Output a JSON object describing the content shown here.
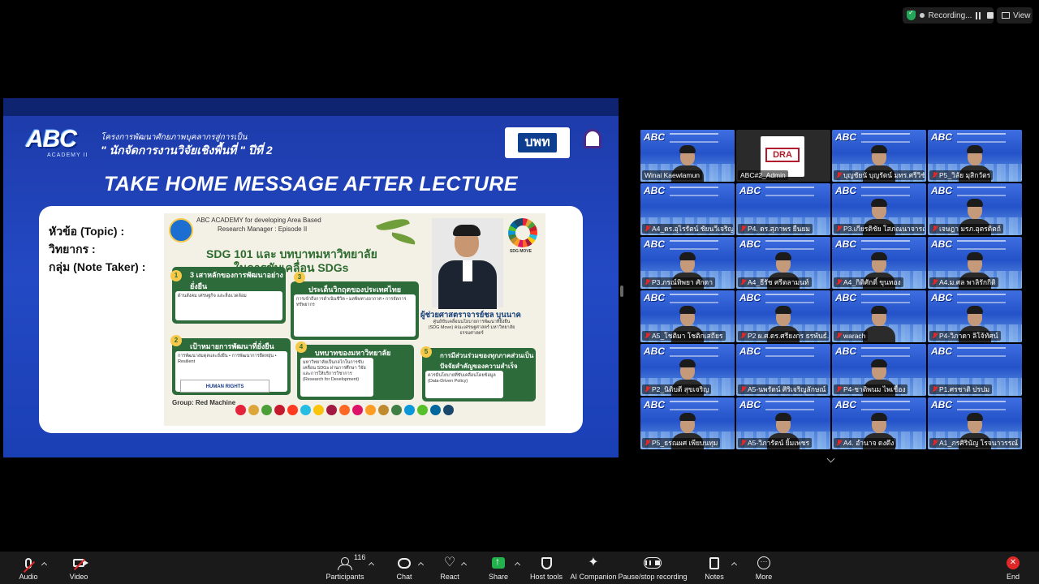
{
  "topbar": {
    "recording_label": "Recording...",
    "view_label": "View",
    "shield_icon": "shield-check-icon",
    "colors": {
      "shield": "#23a55a"
    }
  },
  "shared_slide": {
    "logo_text": "ABC",
    "logo_sub": "ACADEMY II",
    "project_line1": "โครงการพัฒนาศักยภาพบุคลากรสู่การเป็น",
    "project_line2": "\" นักจัดการงานวิจัยเชิงพื้นที่ \" ปีที่ 2",
    "partner_logo": "บพท",
    "title": "TAKE HOME MESSAGE AFTER LECTURE",
    "topic_label": "หัวข้อ (Topic) :",
    "speaker_label": "วิทยากร :",
    "group_label": "กลุ่ม (Note Taker) :",
    "note": {
      "header1": "ABC ACADEMY for developing Area Based",
      "header2": "Research Manager : Episode II",
      "title1": "SDG 101 และ บทบาทมหาวิทยาลัย",
      "title2": "ในการขับเคลื่อน SDGs",
      "sdg_move": "SDG MOVE",
      "speaker_name": "ผู้ช่วยศาสตราจารย์ชล บุนนาค",
      "speaker_desc": "ศูนย์ขับเคลื่อนนโยบายการพัฒนาที่ยั่งยืน (SDG Move) คณะเศรษฐศาสตร์ มหาวิทยาลัยธรรมศาสตร์",
      "box1_title": "3 เสาหลักของการพัฒนาอย่างยั่งยืน",
      "box1_body": "ด้านสังคม เศรษฐกิจ และสิ่งแวดล้อม",
      "box2_title": "เป้าหมายการพัฒนาที่ยั่งยืน",
      "box2_body": "การพัฒนาสมดุลและยั่งยืน • การพัฒนาการยืดหยุ่น • Resilient",
      "box3_title": "ประเด็นวิกฤตของประเทศไทย",
      "box3_body": "การเข้าถึงการดำเนินชีวิต • มลพิษทางอากาศ • การจัดการทรัพยากร",
      "box4_title": "บทบาทของมหาวิทยาลัย",
      "box4_body": "มหาวิทยาลัยเป็นกลไกในการขับเคลื่อน SDGs ผ่านการศึกษา วิจัย และการให้บริการวิชาการ (Research for Development)",
      "box5_title": "การมีส่วนร่วมของทุกภาคส่วนเป็นปัจจัยสำคัญของความสำเร็จ",
      "box5_body": "ควรมีนโยบายที่ขับเคลื่อนโดยข้อมูล (Data-Driven Policy)",
      "human_rights": "HUMAN RIGHTS",
      "group": "Group: Red Machine",
      "sdg_colors": [
        "#e5243b",
        "#dda63a",
        "#4c9f38",
        "#c5192d",
        "#ff3a21",
        "#26bde2",
        "#fcc30b",
        "#a21942",
        "#fd6925",
        "#dd1367",
        "#fd9d24",
        "#bf8b2e",
        "#3f7e44",
        "#0a97d9",
        "#56c02b",
        "#00689d",
        "#19486a"
      ]
    }
  },
  "gallery": {
    "participants": [
      {
        "name": "Winai Kaewlamun",
        "muted": false,
        "active": true,
        "kind": "video"
      },
      {
        "name": "ABC#2_Admin",
        "muted": false,
        "active": false,
        "kind": "logo"
      },
      {
        "name": "บุญชัยนั บุญรัตน์ มทร.ศรีวิชัย",
        "muted": true,
        "active": false,
        "kind": "video"
      },
      {
        "name": "P5_วิลัย มุสิกวัตร",
        "muted": true,
        "active": false,
        "kind": "video"
      },
      {
        "name": "A4_ดร.อุไรรัตน์ ชัยนวีเจริญ",
        "muted": true,
        "active": false,
        "kind": "bg"
      },
      {
        "name": "P4. ดร.สุภาพร ยืนยม",
        "muted": true,
        "active": false,
        "kind": "bg"
      },
      {
        "name": "P3.เกียรติชัย โสภณนาจารณ์",
        "muted": true,
        "active": false,
        "kind": "video"
      },
      {
        "name": "เจษฎา มรภ.อุตรดิตถ์",
        "muted": true,
        "active": false,
        "kind": "video"
      },
      {
        "name": "P3.ภรณ์ทิพยา ศักดา",
        "muted": true,
        "active": false,
        "kind": "video"
      },
      {
        "name": "A4_ธีรัช ศรีตลามนท์",
        "muted": true,
        "active": false,
        "kind": "video"
      },
      {
        "name": "A4_กิติศักดิ์ ขุนทอง",
        "muted": true,
        "active": false,
        "kind": "video"
      },
      {
        "name": "A4.ม.ศล พาลิรักกิติ",
        "muted": true,
        "active": false,
        "kind": "video"
      },
      {
        "name": "A5_โชติมา โชติกเสถียร",
        "muted": true,
        "active": false,
        "kind": "video"
      },
      {
        "name": "P2 ผ.ศ.ดร.ศรียงกร ธรพันธ์...",
        "muted": true,
        "active": false,
        "kind": "video"
      },
      {
        "name": "warach",
        "muted": true,
        "active": false,
        "kind": "video"
      },
      {
        "name": "P4-วิภาดา ลิโจ้ทัศน์",
        "muted": true,
        "active": false,
        "kind": "video"
      },
      {
        "name": "P2_นิติบดี สุขเจริญ",
        "muted": true,
        "active": false,
        "kind": "video"
      },
      {
        "name": "A5-นพรัตน์ ศิริเจริญลักษณ์",
        "muted": true,
        "active": false,
        "kind": "bg"
      },
      {
        "name": "P4-ชาติพนม ไพเชื้อง",
        "muted": true,
        "active": false,
        "kind": "video"
      },
      {
        "name": "P1.ศรชาติ ปรปม",
        "muted": true,
        "active": false,
        "kind": "bg"
      },
      {
        "name": "P5_ธรณผศ เพียบนทุม",
        "muted": true,
        "active": false,
        "kind": "video"
      },
      {
        "name": "A5-วิภารัตน์ ยิ้มเพชร",
        "muted": true,
        "active": false,
        "kind": "video"
      },
      {
        "name": "A4. อำนาจ ดงดึง",
        "muted": true,
        "active": false,
        "kind": "video"
      },
      {
        "name": "A1_ภรศิรินัญ โรจนาวรรณ์",
        "muted": true,
        "active": false,
        "kind": "video"
      }
    ]
  },
  "toolbar": {
    "audio": "Audio",
    "video": "Video",
    "participants": "Participants",
    "participants_count": "116",
    "chat": "Chat",
    "react": "React",
    "share": "Share",
    "host_tools": "Host tools",
    "ai_companion": "AI Companion",
    "pause_recording": "Pause/stop recording",
    "notes": "Notes",
    "more": "More",
    "end": "End",
    "colors": {
      "share": "#23b14d",
      "end": "#e02828",
      "muted": "#e02828"
    }
  }
}
